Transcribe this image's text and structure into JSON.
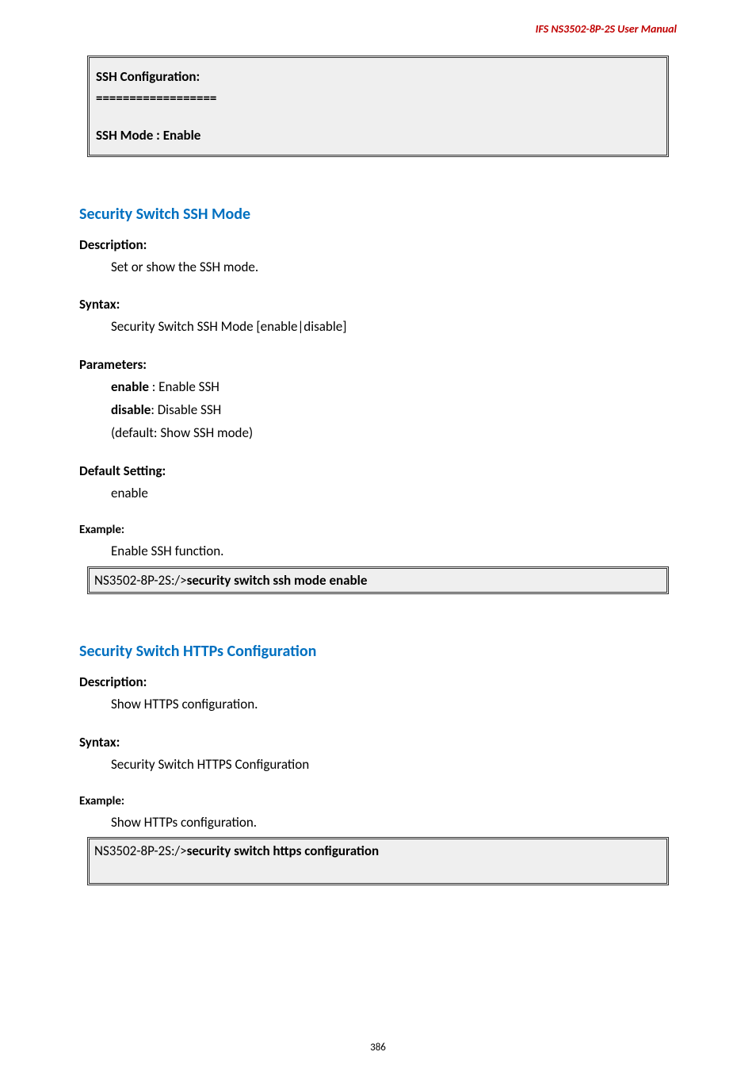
{
  "header": {
    "product": "IFS  NS3502-8P-2S  User  Manual"
  },
  "box1": {
    "line1": "SSH Configuration:",
    "line2": "==================",
    "line3": "SSH Mode : Enable"
  },
  "section1": {
    "title": "Security Switch SSH Mode",
    "desc_label": "Description:",
    "desc_text": "Set or show the SSH mode.",
    "syntax_label": "Syntax:",
    "syntax_text": "Security Switch SSH Mode [enable|disable]",
    "params_label": "Parameters:",
    "param_enable_key": "enable",
    "param_enable_rest": " : Enable SSH",
    "param_disable_key": "disable",
    "param_disable_rest": ": Disable SSH",
    "param_default": "(default: Show SSH mode)",
    "default_label": "Default Setting:",
    "default_text": "enable",
    "example_label": "Example:",
    "example_text": "Enable SSH function.",
    "example_prompt": "NS3502-8P-2S:/>",
    "example_cmd": "security switch ssh mode enable"
  },
  "section2": {
    "title": "Security Switch HTTPs Configuration",
    "desc_label": "Description:",
    "desc_text": "Show HTTPS configuration.",
    "syntax_label": "Syntax:",
    "syntax_text": "Security Switch HTTPS Configuration",
    "example_label": "Example:",
    "example_text": "Show HTTPs configuration.",
    "example_prompt": "NS3502-8P-2S:/>",
    "example_cmd": "security switch https configuration"
  },
  "footer": {
    "page": "386"
  }
}
